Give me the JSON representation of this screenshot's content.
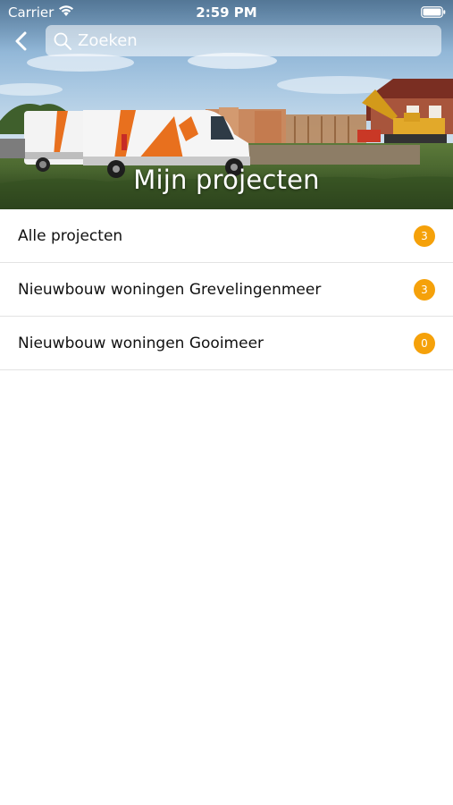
{
  "status_bar": {
    "carrier": "Carrier",
    "time": "2:59 PM"
  },
  "header": {
    "search_placeholder": "Zoeken",
    "title": "Mijn projecten"
  },
  "projects": [
    {
      "label": "Alle projecten",
      "count": "3"
    },
    {
      "label": "Nieuwbouw woningen Grevelingenmeer",
      "count": "3"
    },
    {
      "label": "Nieuwbouw woningen Gooimeer",
      "count": "0"
    }
  ],
  "colors": {
    "badge": "#f5a10a",
    "van_accent": "#e8701e"
  }
}
